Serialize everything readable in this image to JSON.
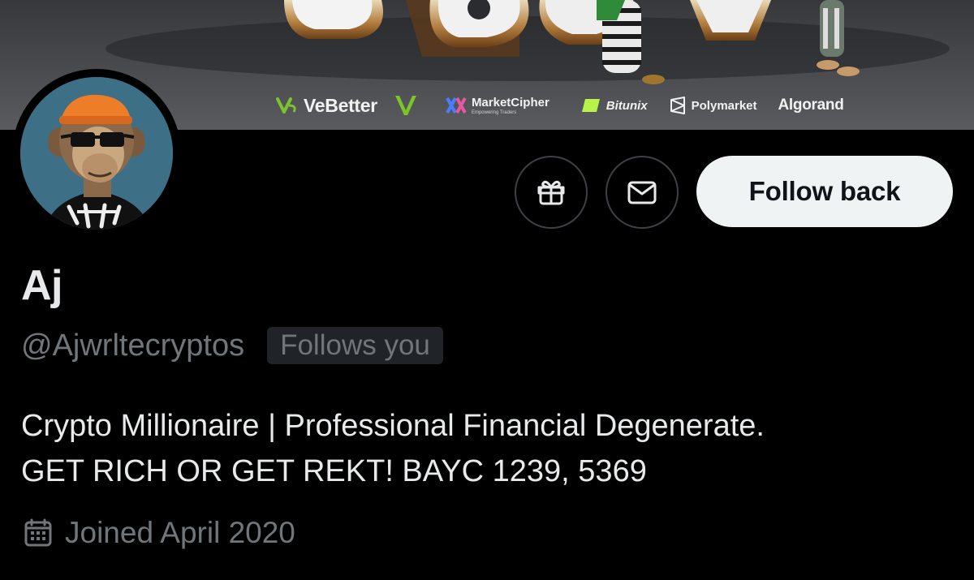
{
  "banner": {
    "sponsors": {
      "vebetter": "VeBetter",
      "marketcipher_title": "MarketCipher",
      "marketcipher_sub": "Empowering Traders",
      "bitunix": "Bitunix",
      "polymarket": "Polymarket",
      "algorand": "Algorand"
    },
    "colors": {
      "vechain_green": "#7cc42a",
      "bitunix_green": "#b7f34b",
      "marketcipher_blue": "#4a7dff"
    }
  },
  "profile": {
    "avatar_icon": "ape-avatar",
    "display_name": "Aj",
    "handle": "@Ajwrltecryptos",
    "follows_badge": "Follows you",
    "bio_line1": "Crypto Millionaire | Professional Financial Degenerate.",
    "bio_line2": "GET RICH OR GET REKT! BAYC 1239, 5369",
    "joined": "Joined April 2020",
    "joined_icon": "calendar-icon"
  },
  "actions": {
    "gift_icon": "gift-icon",
    "message_icon": "envelope-icon",
    "follow_label": "Follow back"
  },
  "colors": {
    "background": "#000000",
    "text_primary": "#e7e9ea",
    "text_secondary": "#71767b",
    "button_bg": "#eff3f4",
    "border": "#3d4145"
  }
}
